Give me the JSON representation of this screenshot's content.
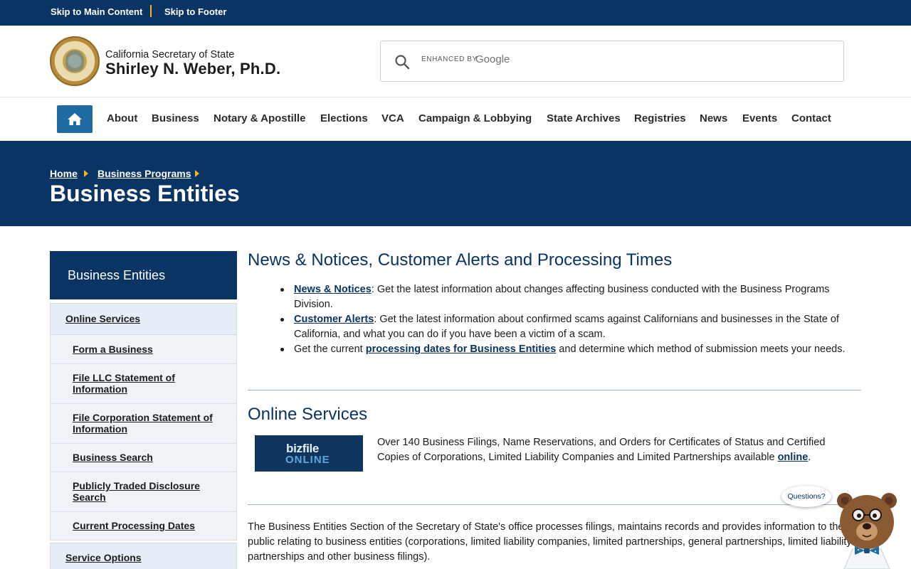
{
  "skip_links": {
    "main": "Skip to Main Content",
    "footer": "Skip to Footer"
  },
  "header": {
    "agency": "California Secretary of State",
    "official": "Shirley N. Weber, Ph.D."
  },
  "search": {
    "enhanced_label": "ENHANCED BY",
    "brand": "Google",
    "icon": "search-icon"
  },
  "nav": {
    "home_icon": "home-icon",
    "items": [
      "About",
      "Business",
      "Notary & Apostille",
      "Elections",
      "VCA",
      "Campaign & Lobbying",
      "State Archives",
      "Registries",
      "News",
      "Events",
      "Contact"
    ]
  },
  "breadcrumb": {
    "items": [
      "Home",
      "Business Programs"
    ]
  },
  "page_title": "Business Entities",
  "sidebar": {
    "heading": "Business Entities",
    "group1": "Online Services",
    "items": [
      "Form a Business",
      "File LLC Statement of Information",
      "File Corporation Statement of Information",
      "Business Search",
      "Publicly Traded Disclosure Search",
      "Current Processing Dates"
    ],
    "group2": "Service Options"
  },
  "news": {
    "heading": "News & Notices, Customer Alerts and Processing Times",
    "b1_link": "News & Notices",
    "b1_text": ": Get the latest information about changes affecting business conducted with the Business Programs Division.",
    "b2_link": "Customer Alerts",
    "b2_text": ": Get the latest information about confirmed scams against Californians and businesses in the State of California, and what you can do if you have been a victim of a scam.",
    "b3_pre": "Get the current ",
    "b3_link": "processing dates for Business Entities",
    "b3_post": " and determine which method of submission meets your needs."
  },
  "online_services": {
    "heading": "Online Services",
    "logo_top": "bizfile",
    "logo_bottom": "ONLINE",
    "text": "Over 140 Business Filings, Name Reservations, and Orders for Certificates of Status and Certified Copies of Corporations, Limited Liability Companies and Limited Partnerships available ",
    "link": "online",
    "end": "."
  },
  "intro_paragraph": "The Business Entities Section of the Secretary of State's office processes filings, maintains records and provides information to the public relating to business entities (corporations, limited liability companies, limited partnerships, general partnerships, limited liability partnerships and other business filings).",
  "chat": {
    "bubble": "Questions?",
    "icon": "bear-assistant-icon"
  },
  "colors": {
    "navy": "#0a3463",
    "accent_gold": "#f1b51c",
    "home_button": "#1f6aa0",
    "sidebar_bg": "#eef3f8"
  }
}
